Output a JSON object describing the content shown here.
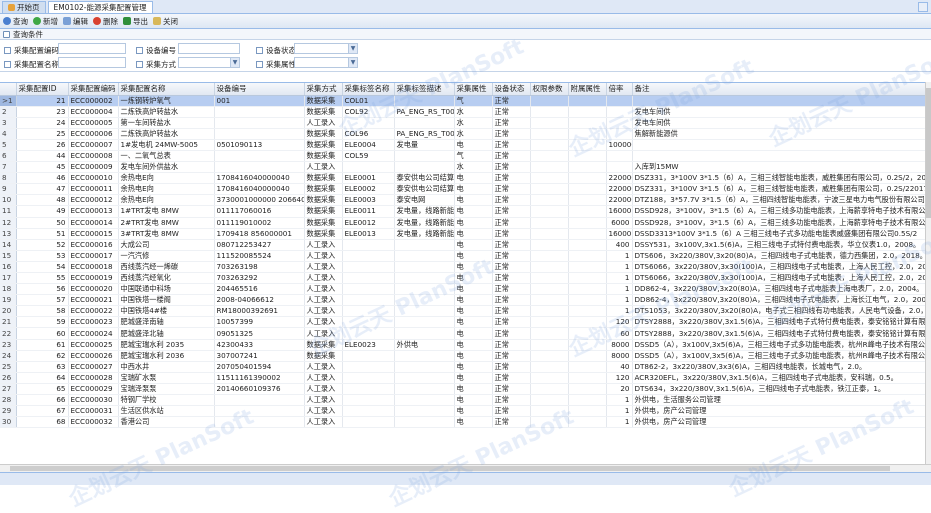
{
  "tabs": [
    {
      "label": "开始页"
    },
    {
      "label": "EM0102-能源采集配置管理"
    }
  ],
  "toolbar": {
    "query": "查询",
    "add": "新增",
    "edit": "编辑",
    "delete": "删除",
    "export": "导出",
    "close": "关闭"
  },
  "section": {
    "title": "查询条件"
  },
  "filters": {
    "config_code": "采集配置编码",
    "device_code": "设备编号",
    "device_status": "设备状态",
    "config_name": "采集配置名称",
    "collect_mode": "采集方式",
    "collect_attr": "采集属性"
  },
  "watermark": "企划云天 PlanSoft",
  "columns": [
    "采集配置ID",
    "采集配置编码",
    "采集配置名称",
    "设备编号",
    "采集方式",
    "采集标签名称",
    "采集标签描述",
    "采集属性",
    "设备状态",
    "权限参数",
    "附属属性",
    "倍率",
    "备注"
  ],
  "rows": [
    {
      "n": ">1",
      "id": "21",
      "code": "ECC000002",
      "name": "一炼钢转炉氧气",
      "dev": "001",
      "mode": "数据采集",
      "tag": "COL01",
      "desc": "",
      "attr": "气",
      "st": "正常",
      "rate": "",
      "note": ""
    },
    {
      "n": "2",
      "id": "23",
      "code": "ECC000004",
      "name": "二炼铁高炉转盐水",
      "dev": "",
      "mode": "数据采集",
      "tag": "COL92",
      "desc": "PA_ENG_RS_T0052",
      "attr": "水",
      "st": "正常",
      "rate": "",
      "note": "发电车间供"
    },
    {
      "n": "3",
      "id": "24",
      "code": "ECC000005",
      "name": "第一车间转盐水",
      "dev": "",
      "mode": "人工录入",
      "tag": "",
      "desc": "",
      "attr": "水",
      "st": "正常",
      "rate": "",
      "note": "发电车间供"
    },
    {
      "n": "4",
      "id": "25",
      "code": "ECC000006",
      "name": "二炼铁高炉转盐水",
      "dev": "",
      "mode": "数据采集",
      "tag": "COL96",
      "desc": "PA_ENG_RS_T0064",
      "attr": "水",
      "st": "正常",
      "rate": "",
      "note": "焦解新能源供"
    },
    {
      "n": "5",
      "id": "26",
      "code": "ECC000007",
      "name": "1#发电机 24MW-5005",
      "dev": "0501090113",
      "mode": "数据采集",
      "tag": "ELE0004",
      "desc": "发电量",
      "attr": "电",
      "st": "正常",
      "rate": "100000",
      "note": ""
    },
    {
      "n": "6",
      "id": "44",
      "code": "ECC000008",
      "name": "一、二氧气总表",
      "dev": "",
      "mode": "数据采集",
      "tag": "COL59",
      "desc": "",
      "attr": "气",
      "st": "正常",
      "rate": "",
      "note": ""
    },
    {
      "n": "7",
      "id": "45",
      "code": "ECC000009",
      "name": "发电车间外供盐水",
      "dev": "",
      "mode": "人工录入",
      "tag": "",
      "desc": "",
      "attr": "水",
      "st": "正常",
      "rate": "",
      "note": "入库到15MW"
    },
    {
      "n": "8",
      "id": "46",
      "code": "ECC000010",
      "name": "余热电E向",
      "dev": "1708416040000040",
      "mode": "数据采集",
      "tag": "ELE0001",
      "desc": "泰安供电公司结算用",
      "attr": "电",
      "st": "正常",
      "rate": "220000",
      "note": "DSZ331，3*100V 3*1.5（6）A，三相三线智能电能表，威胜集团有限公司，0.2S/2，2017年"
    },
    {
      "n": "9",
      "id": "47",
      "code": "ECC000011",
      "name": "余热电E向",
      "dev": "1708416040000040",
      "mode": "数据采集",
      "tag": "ELE0002",
      "desc": "泰安供电公司结算用",
      "attr": "电",
      "st": "正常",
      "rate": "220000",
      "note": "DSZ331，3*100V 3*1.5（6）A，三相三线智能电能表，威胜集团有限公司，0.2S/22017年"
    },
    {
      "n": "10",
      "id": "48",
      "code": "ECC000012",
      "name": "余热电E向",
      "dev": "3730001000000 206640361",
      "mode": "数据采集",
      "tag": "ELE0003",
      "desc": "泰安电网",
      "attr": "电",
      "st": "正常",
      "rate": "220000",
      "note": "DTZ188，3*57.7V 3*1.5（6）A，三相四线智能电能表，宁波三星电力电气股份有限公司，0.2S/2"
    },
    {
      "n": "11",
      "id": "49",
      "code": "ECC000013",
      "name": "1#TRT发电 8MW",
      "dev": "011117060016",
      "mode": "数据采集",
      "tag": "ELE0011",
      "desc": "发电量，线路新能源",
      "attr": "电",
      "st": "正常",
      "rate": "16000",
      "note": "DSSD928，3*100V，3*1.5（6）A，三相三线多功能电能表，上海薪享特电子技术有限公司，0.5S/2，2018"
    },
    {
      "n": "12",
      "id": "50",
      "code": "ECC000014",
      "name": "2#TRT发电 8MW",
      "dev": "011119010002",
      "mode": "数据采集",
      "tag": "ELE0012",
      "desc": "发电量，线路新能源",
      "attr": "电",
      "st": "正常",
      "rate": "6000",
      "note": "DSSD928，3*100V，3*1.5（6）A，三相三线多功能电能表，上海薪享特电子技术有限公司，0.5S/2，2018"
    },
    {
      "n": "13",
      "id": "51",
      "code": "ECC000015",
      "name": "3#TRT发电 8MW",
      "dev": "1709418 856000001",
      "mode": "数据采集",
      "tag": "ELE0013",
      "desc": "发电量，线路新能源",
      "attr": "电",
      "st": "正常",
      "rate": "16000",
      "note": "DSSD3313*100V 3*1.5（6）A 三相三线电子式多功能电能表威盛集团有限公司0.5S/2"
    },
    {
      "n": "14",
      "id": "52",
      "code": "ECC000016",
      "name": "大成公司",
      "dev": "080712253427",
      "mode": "人工录入",
      "tag": "",
      "desc": "",
      "attr": "电",
      "st": "正常",
      "rate": "400",
      "note": "DSSY531，3x100V,3x1.5(6)A，三相三线电子式特付费电能表，华立仪表1.0，2008。"
    },
    {
      "n": "15",
      "id": "53",
      "code": "ECC000017",
      "name": "一汽汽修",
      "dev": "111520085524",
      "mode": "人工录入",
      "tag": "",
      "desc": "",
      "attr": "电",
      "st": "正常",
      "rate": "1",
      "note": "DTS606，3x220/380V,3x20(80)A，三相四线电子式电能表，德力西集团，2.0，2018。"
    },
    {
      "n": "16",
      "id": "54",
      "code": "ECC000018",
      "name": "西线蒸汽经一烯碳",
      "dev": "703263198",
      "mode": "人工录入",
      "tag": "",
      "desc": "",
      "attr": "电",
      "st": "正常",
      "rate": "1",
      "note": "DTS6066，3x220/380V,3x30(100)A，三相四线电子式电能表，上海人民工控，2.0，2018。"
    },
    {
      "n": "17",
      "id": "55",
      "code": "ECC000019",
      "name": "西线蒸汽经氧化",
      "dev": "703263292",
      "mode": "人工录入",
      "tag": "",
      "desc": "",
      "attr": "电",
      "st": "正常",
      "rate": "1",
      "note": "DTS6066，3x220/380V,3x30(100)A，三相四线电子式电能表，上海人民工控，2.0，2018。"
    },
    {
      "n": "18",
      "id": "56",
      "code": "ECC000020",
      "name": "中国联通中科场",
      "dev": "204465516",
      "mode": "人工录入",
      "tag": "",
      "desc": "",
      "attr": "电",
      "st": "正常",
      "rate": "1",
      "note": "DD862-4，3x220/380V,3x20(80)A，三相四线电子式电能表上海电表厂，2.0，2004。"
    },
    {
      "n": "19",
      "id": "57",
      "code": "ECC000021",
      "name": "中国铁塔一楼阁",
      "dev": "2008-04066612",
      "mode": "人工录入",
      "tag": "",
      "desc": "",
      "attr": "电",
      "st": "正常",
      "rate": "1",
      "note": "DD862-4，3x220/380V,3x20(80)A，三相四线电子式电能表，上海长江电气，2.0，2008。"
    },
    {
      "n": "20",
      "id": "58",
      "code": "ECC000022",
      "name": "中国铁塔4#楼",
      "dev": "RM18000392691",
      "mode": "人工录入",
      "tag": "",
      "desc": "",
      "attr": "电",
      "st": "正常",
      "rate": "1",
      "note": "DTS1053，3x220/380V,3x20(80)A，电子式三相四线有功电能表，人民电气设备，2.0，2018"
    },
    {
      "n": "21",
      "id": "59",
      "code": "ECC000023",
      "name": "肥城盛泽南轴",
      "dev": "10057399",
      "mode": "人工录入",
      "tag": "",
      "desc": "",
      "attr": "电",
      "st": "正常",
      "rate": "120",
      "note": "DTSY2888，3x220/380V,3x1.5(6)A，三相四线电子式特付费电能表，泰安铭铭计算有限公司，2.0，201…"
    },
    {
      "n": "22",
      "id": "60",
      "code": "ECC000024",
      "name": "肥城盛泽北轴",
      "dev": "09051325",
      "mode": "人工录入",
      "tag": "",
      "desc": "",
      "attr": "电",
      "st": "正常",
      "rate": "60",
      "note": "DTSY2888，3x220/380V,3x1.5(6)A，三相四线电子式特付费电能表，泰安铭铭计算有限公司，2.0，2009"
    },
    {
      "n": "23",
      "id": "61",
      "code": "ECC000025",
      "name": "肥城宝瑞水利 2035",
      "dev": "42300433",
      "mode": "数据采集",
      "tag": "ELE0023",
      "desc": "外供电",
      "attr": "电",
      "st": "正常",
      "rate": "8000",
      "note": "DSSD5（A），3x100V,3x5(6)A，三相三线电子式多功能电能表，杭州R峰电子技术有限公司，0.5。"
    },
    {
      "n": "24",
      "id": "62",
      "code": "ECC000026",
      "name": "肥城宝瑞水利 2036",
      "dev": "307007241",
      "mode": "数据采集",
      "tag": "",
      "desc": "",
      "attr": "电",
      "st": "正常",
      "rate": "8000",
      "note": "DSSD5（A），3x100V,3x5(6)A，三相三线电子式多功能电能表，杭州R峰电子技术有限公司，0.5。"
    },
    {
      "n": "25",
      "id": "63",
      "code": "ECC000027",
      "name": "中西水井",
      "dev": "207050401594",
      "mode": "人工录入",
      "tag": "",
      "desc": "",
      "attr": "电",
      "st": "正常",
      "rate": "40",
      "note": "DT862-2，3x220/380V,3x3(6)A，三相四线电能表，长城电气，2.0。"
    },
    {
      "n": "26",
      "id": "64",
      "code": "ECC000028",
      "name": "宝瑞矿水泵",
      "dev": "11511161390002",
      "mode": "人工录入",
      "tag": "",
      "desc": "",
      "attr": "电",
      "st": "正常",
      "rate": "120",
      "note": "ACR320EFL，3x220/380V,3x1.5(6)A，三相四线电子式电能表，安科瑞，0.5。"
    },
    {
      "n": "27",
      "id": "65",
      "code": "ECC000029",
      "name": "宝瑞泽泵泵",
      "dev": "20140660109376",
      "mode": "人工录入",
      "tag": "",
      "desc": "",
      "attr": "电",
      "st": "正常",
      "rate": "20",
      "note": "DTS634，3x220/380V,3x1.5(6)A，三相四线电子式电能表，铁江正泰，1。"
    },
    {
      "n": "28",
      "id": "66",
      "code": "ECC000030",
      "name": "特钢厂学校",
      "dev": "",
      "mode": "人工录入",
      "tag": "",
      "desc": "",
      "attr": "电",
      "st": "正常",
      "rate": "1",
      "note": "外供电，生活服务公司管理"
    },
    {
      "n": "29",
      "id": "67",
      "code": "ECC000031",
      "name": "生活区供水站",
      "dev": "",
      "mode": "人工录入",
      "tag": "",
      "desc": "",
      "attr": "电",
      "st": "正常",
      "rate": "1",
      "note": "外供电，房产公司管理"
    },
    {
      "n": "30",
      "id": "68",
      "code": "ECC000032",
      "name": "香港公司",
      "dev": "",
      "mode": "人工录入",
      "tag": "",
      "desc": "",
      "attr": "电",
      "st": "正常",
      "rate": "1",
      "note": "外供电，房产公司管理"
    }
  ]
}
